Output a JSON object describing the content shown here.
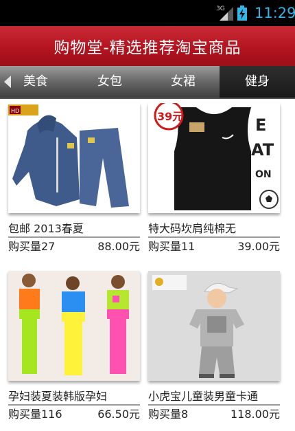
{
  "status": {
    "network": "3G",
    "time": "11:29"
  },
  "header": {
    "title": "购物堂-精选推荐淘宝商品"
  },
  "tabs": [
    {
      "label": "美食"
    },
    {
      "label": "女包"
    },
    {
      "label": "女裙"
    },
    {
      "label": "健身"
    }
  ],
  "products": [
    {
      "name": "包邮 2013春夏",
      "sales": "购买量27",
      "price": "88.00元",
      "image": "blue-tracksuit",
      "badge": "HD"
    },
    {
      "name": "特大码坎肩纯棉无",
      "sales": "购买量11",
      "price": "39.00元",
      "image": "black-vest",
      "badge": "39元"
    },
    {
      "name": "孕妇装夏装韩版孕妇",
      "sales": "购买量116",
      "price": "66.50元",
      "image": "maternity-outfits"
    },
    {
      "name": "小虎宝儿童装男童卡通",
      "sales": "购买量8",
      "price": "118.00元",
      "image": "kids-outfit"
    }
  ],
  "colors": {
    "title_bar": "#b3141f",
    "status_accent": "#33b5e5",
    "active_tab": "#1f1f1f"
  }
}
